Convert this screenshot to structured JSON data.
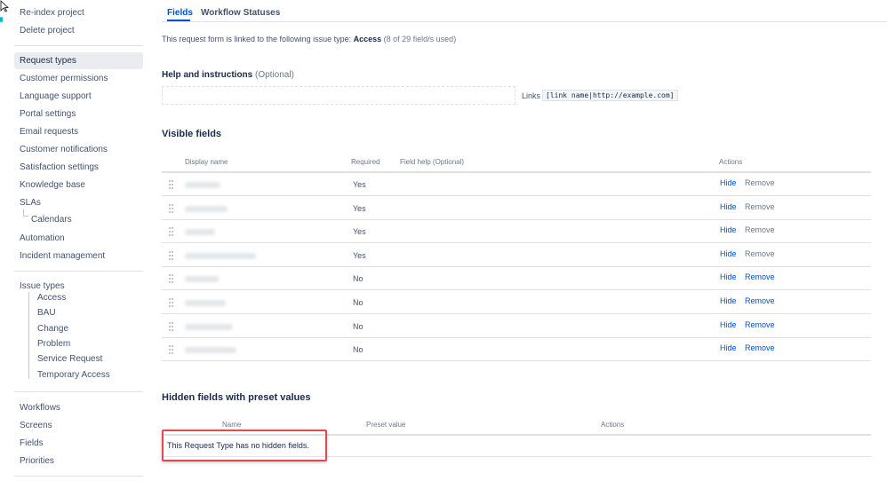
{
  "sidebar": {
    "top_items": [
      "Re-index project",
      "Delete project"
    ],
    "items": [
      "Request types",
      "Customer permissions",
      "Language support",
      "Portal settings",
      "Email requests",
      "Customer notifications",
      "Satisfaction settings",
      "Knowledge base",
      "SLAs",
      "Calendars",
      "Automation",
      "Incident management"
    ],
    "issue_types_label": "Issue types",
    "issue_types": [
      "Access",
      "BAU",
      "Change",
      "Problem",
      "Service Request",
      "Temporary Access"
    ],
    "bottom_items": [
      "Workflows",
      "Screens",
      "Fields",
      "Priorities"
    ]
  },
  "tabs": [
    "Fields",
    "Workflow Statuses"
  ],
  "info": {
    "prefix": "This request form is linked to the following issue type: ",
    "issue_type": "Access",
    "count": " (8 of 29 field/s used)"
  },
  "help": {
    "label": "Help and instructions",
    "optional": " (Optional)",
    "links_label": "Links",
    "links_code": "[link name|http://example.com]"
  },
  "visible_fields": {
    "title": "Visible fields",
    "headers": {
      "display_name": "Display name",
      "required": "Required",
      "field_help": "Field help",
      "field_help_optional": " (Optional)",
      "actions": "Actions"
    },
    "rows": [
      {
        "required": "Yes",
        "hide": "Hide",
        "remove": "Remove"
      },
      {
        "required": "Yes",
        "hide": "Hide",
        "remove": "Remove"
      },
      {
        "required": "Yes",
        "hide": "Hide",
        "remove": "Remove"
      },
      {
        "required": "Yes",
        "hide": "Hide",
        "remove": "Remove"
      },
      {
        "required": "No",
        "hide": "Hide",
        "remove": "Remove"
      },
      {
        "required": "No",
        "hide": "Hide",
        "remove": "Remove"
      },
      {
        "required": "No",
        "hide": "Hide",
        "remove": "Remove"
      },
      {
        "required": "No",
        "hide": "Hide",
        "remove": "Remove"
      }
    ]
  },
  "hidden_fields": {
    "title": "Hidden fields with preset values",
    "headers": {
      "name": "Name",
      "preset_value": "Preset value",
      "actions": "Actions"
    },
    "empty_message": "This Request Type has no hidden fields."
  },
  "colors": {
    "accent": "#0052cc",
    "highlight_box": "#e5484d",
    "text": "#172b4d"
  }
}
